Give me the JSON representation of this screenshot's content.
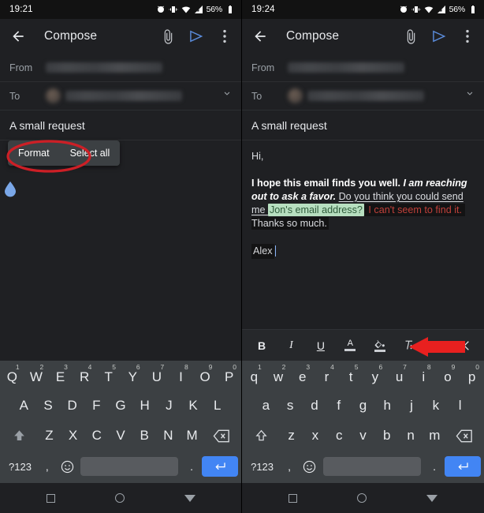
{
  "panels": [
    {
      "id": "left",
      "status": {
        "time": "19:21",
        "battery_pct": "56%",
        "icons": [
          "alarm-icon",
          "vibrate-icon",
          "wifi-icon",
          "signal-icon",
          "battery-icon"
        ]
      },
      "appbar": {
        "title": "Compose",
        "back": "back-arrow-icon",
        "attach": "attachment-icon",
        "send": "send-icon",
        "more": "more-vert-icon"
      },
      "fields": {
        "from_label": "From",
        "to_label": "To",
        "from_value": "",
        "to_value": "",
        "dropdown": "chevron-down-icon"
      },
      "subject": "A small request",
      "body": {
        "lines": []
      },
      "context_menu": {
        "visible": true,
        "items": [
          "Format",
          "Select all"
        ]
      },
      "cursor_handle": "text-cursor-handle",
      "annotation": {
        "type": "ellipse",
        "color": "#cc1f26",
        "target": "Format"
      },
      "format_toolbar": {
        "visible": false
      },
      "keyboard": {
        "shift_state": "caps",
        "row1": [
          {
            "k": "Q",
            "n": "1"
          },
          {
            "k": "W",
            "n": "2"
          },
          {
            "k": "E",
            "n": "3"
          },
          {
            "k": "R",
            "n": "4"
          },
          {
            "k": "T",
            "n": "5"
          },
          {
            "k": "Y",
            "n": "6"
          },
          {
            "k": "U",
            "n": "7"
          },
          {
            "k": "I",
            "n": "8"
          },
          {
            "k": "O",
            "n": "9"
          },
          {
            "k": "P",
            "n": "0"
          }
        ],
        "row2": [
          "A",
          "S",
          "D",
          "F",
          "G",
          "H",
          "J",
          "K",
          "L"
        ],
        "row3": [
          "Z",
          "X",
          "C",
          "V",
          "B",
          "N",
          "M"
        ],
        "sym_label": "?123",
        "comma": ",",
        "period": ".",
        "emoji": "emoji-icon",
        "space": "spacebar",
        "enter": "enter-icon",
        "shift": "shift-icon",
        "backspace": "backspace-icon"
      }
    },
    {
      "id": "right",
      "status": {
        "time": "19:24",
        "battery_pct": "56%",
        "icons": [
          "alarm-icon",
          "vibrate-icon",
          "wifi-icon",
          "signal-icon",
          "battery-icon"
        ]
      },
      "appbar": {
        "title": "Compose",
        "back": "back-arrow-icon",
        "attach": "attachment-icon",
        "send": "send-icon",
        "more": "more-vert-icon"
      },
      "fields": {
        "from_label": "From",
        "to_label": "To",
        "from_value": "",
        "to_value": "",
        "dropdown": "chevron-down-icon"
      },
      "subject": "A small request",
      "body": {
        "greeting": "Hi,",
        "seg_bold_1": "I hope this email finds you well. ",
        "seg_bolditalic": "I am reaching out to ask a favor. ",
        "seg_underline": "Do you think you could send me ",
        "seg_highlight": "Jon's email address?",
        "seg_red": " I can't seem to find it.",
        "seg_plain": " Thanks so much.",
        "signature": "Alex"
      },
      "context_menu": {
        "visible": false,
        "items": []
      },
      "annotation": {
        "type": "arrow",
        "color": "#e8201f",
        "direction": "left"
      },
      "format_toolbar": {
        "visible": true,
        "buttons": [
          "bold-icon",
          "italic-icon",
          "underline-icon",
          "text-color-icon",
          "highlight-color-icon",
          "clear-formatting-icon"
        ],
        "labels": [
          "B",
          "I",
          "U",
          "A"
        ],
        "close": "close-icon"
      },
      "keyboard": {
        "shift_state": "off",
        "row1": [
          {
            "k": "q",
            "n": "1"
          },
          {
            "k": "w",
            "n": "2"
          },
          {
            "k": "e",
            "n": "3"
          },
          {
            "k": "r",
            "n": "4"
          },
          {
            "k": "t",
            "n": "5"
          },
          {
            "k": "y",
            "n": "6"
          },
          {
            "k": "u",
            "n": "7"
          },
          {
            "k": "i",
            "n": "8"
          },
          {
            "k": "o",
            "n": "9"
          },
          {
            "k": "p",
            "n": "0"
          }
        ],
        "row2": [
          "a",
          "s",
          "d",
          "f",
          "g",
          "h",
          "j",
          "k",
          "l"
        ],
        "row3": [
          "z",
          "x",
          "c",
          "v",
          "b",
          "n",
          "m"
        ],
        "sym_label": "?123",
        "comma": ",",
        "period": ".",
        "emoji": "emoji-icon",
        "space": "spacebar",
        "enter": "enter-icon",
        "shift": "shift-icon",
        "backspace": "backspace-icon"
      }
    }
  ],
  "navbar": {
    "recents": "square-icon",
    "home": "circle-icon",
    "back": "triangle-back-icon"
  },
  "colors": {
    "accent": "#8ab4f8",
    "enter_key": "#4285f4",
    "highlight_green": "#b7dfc0",
    "text_red": "#c0403a",
    "annotation_red": "#e8201f",
    "keyboard_bg": "#3c4043"
  }
}
